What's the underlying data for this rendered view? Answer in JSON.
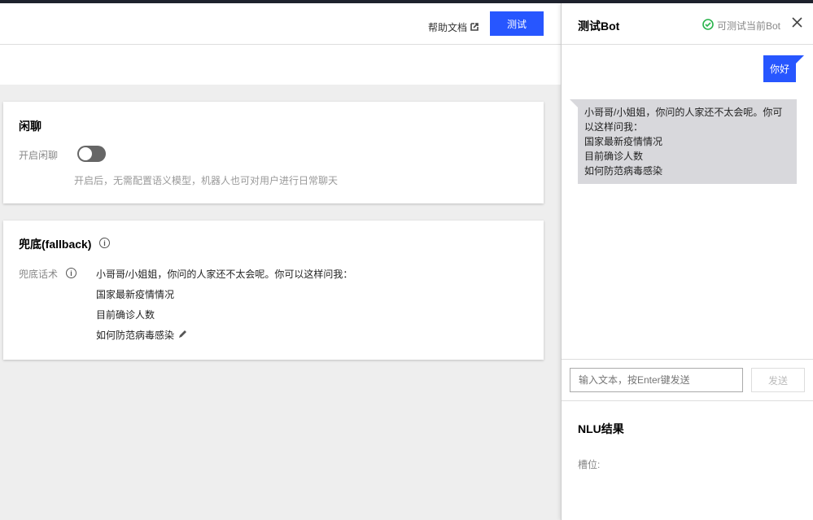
{
  "header": {
    "help_label": "帮助文档",
    "test_button": "测试"
  },
  "chitchat": {
    "title": "闲聊",
    "toggle_label": "开启闲聊",
    "toggle_on": false,
    "description": "开启后，无需配置语义模型，机器人也可对用户进行日常聊天"
  },
  "fallback": {
    "title": "兜底(fallback)",
    "field_label": "兜底话术",
    "lines": [
      "小哥哥/小姐姐，你问的人家还不太会呢。你可以这样问我：",
      "国家最新疫情情况",
      "目前确诊人数",
      "如何防范病毒感染"
    ]
  },
  "panel": {
    "title": "测试Bot",
    "status": "可测试当前Bot",
    "status_color": "#29b34b",
    "messages": [
      {
        "from": "user",
        "text": "你好"
      },
      {
        "from": "bot",
        "lines": [
          "小哥哥/小姐姐，你问的人家还不太会呢。你可",
          "以这样问我：",
          "国家最新疫情情况",
          "目前确诊人数",
          "如何防范病毒感染"
        ]
      }
    ],
    "input_placeholder": "输入文本，按Enter键发送",
    "send_label": "发送",
    "nlu_title": "NLU结果",
    "slot_label": "槽位:"
  }
}
